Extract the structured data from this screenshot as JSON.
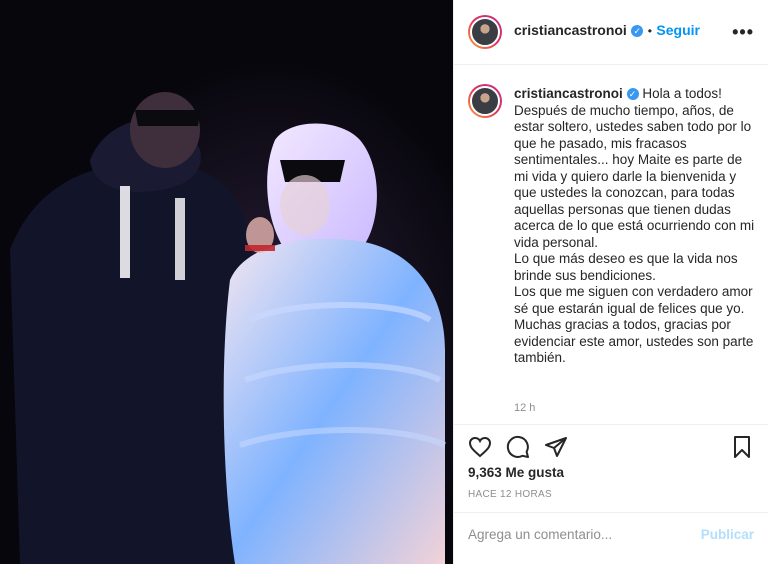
{
  "header": {
    "username": "cristiancastronoi",
    "verified_icon": "verified-badge-icon",
    "separator": "•",
    "follow_label": "Seguir",
    "more_label": "•••"
  },
  "caption": {
    "username": "cristiancastronoi",
    "text": "Hola a todos!\nDespués de mucho tiempo, años, de estar soltero, ustedes saben todo por lo que he pasado, mis fracasos sentimentales... hoy Maite es parte de mi vida y quiero darle la bienvenida y que ustedes la conozcan, para todas aquellas personas que tienen dudas acerca de lo que está ocurriendo con mi vida personal.\nLo que más deseo es que la vida nos brinde sus bendiciones.\nLos que me siguen con verdadero amor sé que estarán igual de felices que yo.\nMuchas gracias a todos, gracias por evidenciar este amor, ustedes son parte también.",
    "time": "12 h"
  },
  "actions": {
    "icons": [
      "heart-icon",
      "comment-icon",
      "share-icon",
      "bookmark-icon"
    ],
    "likes": "9,363 Me gusta",
    "time_ago": "HACE 12 HORAS"
  },
  "comment": {
    "placeholder": "Agrega un comentario...",
    "publish_label": "Publicar"
  },
  "colors": {
    "accent": "#0095f6",
    "verified": "#3897f0",
    "publish_disabled": "#b2dffc",
    "text": "#262626",
    "muted": "#8e8e8e"
  }
}
